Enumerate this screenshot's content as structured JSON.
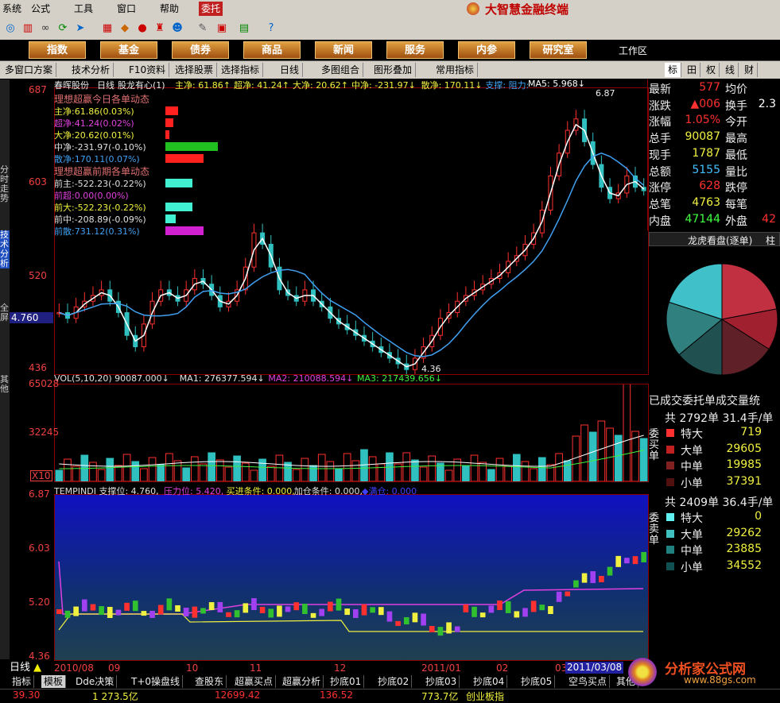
{
  "app": {
    "title": "大智慧金融终端",
    "active_menu": "委托"
  },
  "menu": [
    "系统",
    "公式",
    "工具",
    "窗口",
    "帮助",
    "委托"
  ],
  "nav": [
    "指数",
    "基金",
    "债券",
    "商品",
    "新闻",
    "服务",
    "内参",
    "研究室"
  ],
  "nav_right": "工作区",
  "subbar": [
    "多窗口方案",
    "技术分析",
    "F10资料",
    "选择股票",
    "选择指标",
    "日线",
    "多图组合",
    "图形叠加",
    "常用指标"
  ],
  "side_tabs": [
    "分时走势",
    "技术分析",
    "全屏",
    "其他"
  ],
  "right_tabs": [
    "标",
    "田",
    "权",
    "线",
    "财"
  ],
  "stock": {
    "name": "春晖股份",
    "period": "日线",
    "indicator": "股龙有心(1)",
    "price_marker": "4.760"
  },
  "main_header": [
    {
      "t": "主净: 61.86↑",
      "c": "#f0f040"
    },
    {
      "t": "超净: 41.24↑",
      "c": "#f0f040"
    },
    {
      "t": "大净: 20.62↑",
      "c": "#f0f040"
    },
    {
      "t": "中净: -231.97↓",
      "c": "#f0f040"
    },
    {
      "t": "散净: 170.11↓",
      "c": "#f0f040"
    },
    {
      "t": "支撑: 阻力:",
      "c": "#40a0f0"
    },
    {
      "t": "MA5: 5.968↓",
      "c": "#ffffff"
    }
  ],
  "main_axis": [
    "687",
    "603",
    "520",
    "436"
  ],
  "panel": {
    "title1": "理想超赢今日各单动态",
    "rows1": [
      {
        "label": "主净:61.86(0.03%)",
        "color": "#f0f040",
        "bar": "#ff2020",
        "w": 16
      },
      {
        "label": "超净:41.24(0.02%)",
        "color": "#e040e0",
        "bar": "#ff2020",
        "w": 10
      },
      {
        "label": "大净:20.62(0.01%)",
        "color": "#f0f040",
        "bar": "#ff2020",
        "w": 5
      },
      {
        "label": "中净:-231.97(-0.10%)",
        "color": "#e0e0e0",
        "bar": "#20c020",
        "w": 66
      },
      {
        "label": "散净:170.11(0.07%)",
        "color": "#40a0f0",
        "bar": "#ff2020",
        "w": 48
      }
    ],
    "title2": "理想超赢前期各单动态",
    "rows2": [
      {
        "label": "前主:-522.23(-0.22%)",
        "color": "#e0e0e0",
        "bar": "#40f0d0",
        "w": 34
      },
      {
        "label": "前超:0.00(0.00%)",
        "color": "#e040e0",
        "bar": "#40f0d0",
        "w": 0
      },
      {
        "label": "前大:-522.23(-0.22%)",
        "color": "#f0f040",
        "bar": "#40f0d0",
        "w": 34
      },
      {
        "label": "前中:-208.89(-0.09%)",
        "color": "#e0e0e0",
        "bar": "#40f0d0",
        "w": 13
      },
      {
        "label": "前散:731.12(0.31%)",
        "color": "#40a0f0",
        "bar": "#d020d0",
        "w": 48
      }
    ]
  },
  "annotations": {
    "high": "6.87",
    "low": "4.36"
  },
  "vol": {
    "header": [
      {
        "t": "VOL(5,10,20) 90087.000↓",
        "c": "#e0e0e0"
      },
      {
        "t": "MA1: 276377.594↓",
        "c": "#e0e0e0"
      },
      {
        "t": "MA2: 210088.594↓",
        "c": "#e040e0"
      },
      {
        "t": "MA3: 217439.656↓",
        "c": "#40f040"
      }
    ],
    "axis": [
      "65028",
      "32245"
    ],
    "unit": "X10"
  },
  "ind": {
    "header": [
      {
        "t": "TEMPINDI 支撑位: 4.760,",
        "c": "#e0e0e0"
      },
      {
        "t": "压力位: 5.420,",
        "c": "#e040e0"
      },
      {
        "t": "买进条件: 0.000,",
        "c": "#f0f040"
      },
      {
        "t": "加仓条件: 0.000,",
        "c": "#e0e0e0"
      },
      {
        "t": "◆满仓: 0.000",
        "c": "#4040ff"
      }
    ],
    "axis": [
      "6.87",
      "6.03",
      "5.20",
      "4.36"
    ]
  },
  "dates": [
    "2010/08",
    "09",
    "10",
    "11",
    "12",
    "2011/01",
    "02",
    "03"
  ],
  "date_highlight": "2011/03/08",
  "period_btn": "日线",
  "bottom_tabs": [
    "指标",
    "模板",
    "Dde决策",
    "T+0操盘线",
    "查股东",
    "超赢买点",
    "超赢分析",
    "抄底01",
    "抄底02",
    "抄底03",
    "抄底04",
    "抄底05",
    "空鸟买点",
    "其他"
  ],
  "status": [
    "39.30",
    "1 273.5亿",
    "12699.42",
    "136.52",
    "773.7亿",
    "创业板指"
  ],
  "quote": [
    {
      "l": "最新",
      "v": "577",
      "vc": "#ff3030",
      "l2": "均价",
      "v2": "",
      "v2c": "#fff"
    },
    {
      "l": "涨跌",
      "v": "▲006",
      "vc": "#ff3030",
      "l2": "换手",
      "v2": "2.3",
      "v2c": "#fff"
    },
    {
      "l": "涨幅",
      "v": "1.05%",
      "vc": "#ff3030",
      "l2": "今开",
      "v2": "",
      "v2c": "#fff"
    },
    {
      "l": "总手",
      "v": "90087",
      "vc": "#f0f040",
      "l2": "最高",
      "v2": "",
      "v2c": "#fff"
    },
    {
      "l": "现手",
      "v": "1787",
      "vc": "#f0f040",
      "l2": "最低",
      "v2": "",
      "v2c": "#fff"
    },
    {
      "l": "总额",
      "v": "5155",
      "vc": "#40c0ff",
      "l2": "量比",
      "v2": "",
      "v2c": "#fff"
    },
    {
      "l": "涨停",
      "v": "628",
      "vc": "#ff3030",
      "l2": "跌停",
      "v2": "",
      "v2c": "#fff"
    },
    {
      "l": "总笔",
      "v": "4763",
      "vc": "#f0f040",
      "l2": "每笔",
      "v2": "",
      "v2c": "#fff"
    },
    {
      "l": "内盘",
      "v": "47144",
      "vc": "#40ff40",
      "l2": "外盘",
      "v2": "42",
      "v2c": "#ff3030"
    }
  ],
  "dragon": {
    "title": "龙虎看盘(逐单)",
    "tab2": "柱"
  },
  "pie": [
    0.22,
    0.12,
    0.16,
    0.14,
    0.16,
    0.2
  ],
  "orders_title": "已成交委托单成交量统",
  "orders": [
    {
      "total": "共 2792单 31.4手/单",
      "side": "委买单",
      "rows": [
        {
          "k": "特大",
          "v": "719",
          "c": "#ff3030"
        },
        {
          "k": "大单",
          "v": "29605",
          "c": "#c02020"
        },
        {
          "k": "中单",
          "v": "19985",
          "c": "#802020"
        },
        {
          "k": "小单",
          "v": "37391",
          "c": "#501010"
        }
      ]
    },
    {
      "total": "共 2409单 36.4手/单",
      "side": "委卖单",
      "rows": [
        {
          "k": "特大",
          "v": "0",
          "c": "#60f0f0"
        },
        {
          "k": "大单",
          "v": "29262",
          "c": "#40c0c0"
        },
        {
          "k": "中单",
          "v": "23885",
          "c": "#208080"
        },
        {
          "k": "小单",
          "v": "34552",
          "c": "#105050"
        }
      ]
    }
  ],
  "watermark": {
    "text": "分析家公式网",
    "url": "www.88gs.com"
  }
}
